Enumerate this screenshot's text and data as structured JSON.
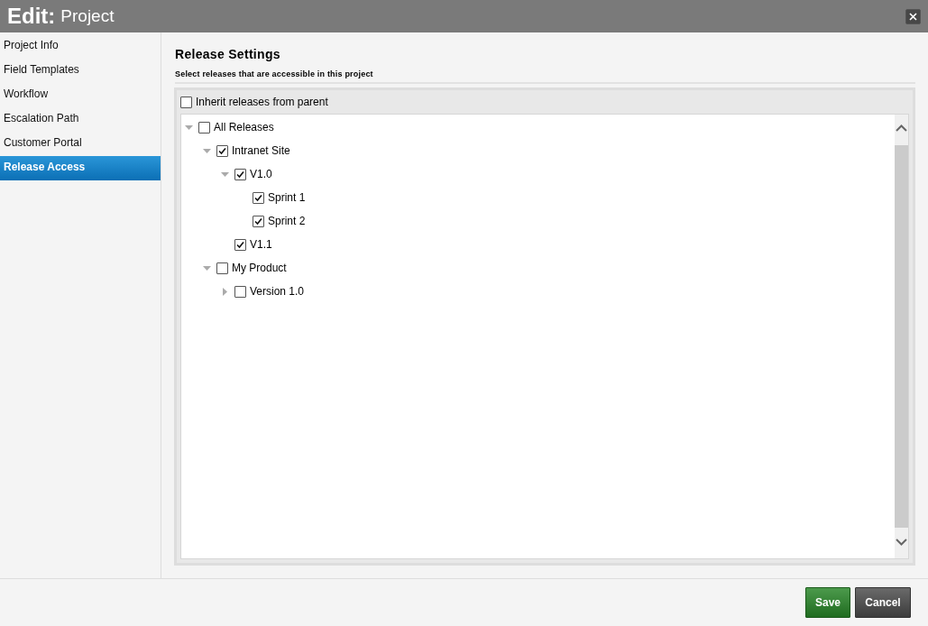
{
  "window": {
    "title_bold": "Edit:",
    "title": "Project"
  },
  "sidebar": {
    "items": [
      {
        "label": "Project Info",
        "selected": false
      },
      {
        "label": "Field Templates",
        "selected": false
      },
      {
        "label": "Workflow",
        "selected": false
      },
      {
        "label": "Escalation Path",
        "selected": false
      },
      {
        "label": "Customer Portal",
        "selected": false
      },
      {
        "label": "Release Access",
        "selected": true
      }
    ]
  },
  "section": {
    "title": "Release Settings",
    "subtitle": "Select releases that are accessible in this project"
  },
  "inherit": {
    "label": "Inherit releases from parent",
    "checked": false
  },
  "tree": [
    {
      "label": "All Releases",
      "checked": false,
      "kind": "branch",
      "expanded": true,
      "children": [
        {
          "label": "Intranet Site",
          "checked": true,
          "kind": "branch",
          "expanded": true,
          "children": [
            {
              "label": "V1.0",
              "checked": true,
              "kind": "branch",
              "expanded": true,
              "children": [
                {
                  "label": "Sprint 1",
                  "checked": true,
                  "kind": "leaf"
                },
                {
                  "label": "Sprint 2",
                  "checked": true,
                  "kind": "leaf"
                }
              ]
            },
            {
              "label": "V1.1",
              "checked": true,
              "kind": "leaf"
            }
          ]
        },
        {
          "label": "My Product",
          "checked": false,
          "kind": "branch",
          "expanded": true,
          "children": [
            {
              "label": "Version 1.0",
              "checked": false,
              "kind": "branch",
              "expanded": false
            }
          ]
        }
      ]
    }
  ],
  "buttons": [
    {
      "label": "Save",
      "kind": "primary"
    },
    {
      "label": "Cancel",
      "kind": "secondary"
    }
  ]
}
